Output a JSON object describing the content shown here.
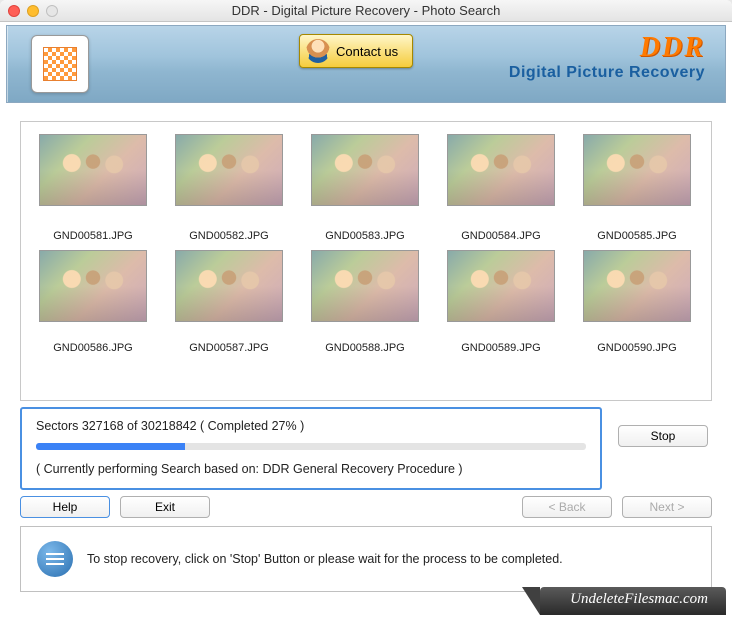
{
  "window": {
    "title": "DDR - Digital Picture Recovery - Photo Search"
  },
  "banner": {
    "contact_label": "Contact us",
    "brand_main": "DDR",
    "brand_sub": "Digital Picture Recovery"
  },
  "thumbnails": {
    "row1": [
      {
        "name": "GND00581.JPG"
      },
      {
        "name": "GND00582.JPG"
      },
      {
        "name": "GND00583.JPG"
      },
      {
        "name": "GND00584.JPG"
      },
      {
        "name": "GND00585.JPG"
      }
    ],
    "row2": [
      {
        "name": "GND00586.JPG"
      },
      {
        "name": "GND00587.JPG"
      },
      {
        "name": "GND00588.JPG"
      },
      {
        "name": "GND00589.JPG"
      },
      {
        "name": "GND00590.JPG"
      }
    ]
  },
  "progress": {
    "sectors_current": "327168",
    "sectors_total": "30218842",
    "percent": 27,
    "line1": "Sectors 327168 of 30218842   ( Completed 27% )",
    "line2": "( Currently performing Search based on: DDR General Recovery Procedure )"
  },
  "buttons": {
    "stop": "Stop",
    "help": "Help",
    "exit": "Exit",
    "back": "< Back",
    "next": "Next >"
  },
  "info": {
    "text": "To stop recovery, click on 'Stop' Button or please wait for the process to be completed."
  },
  "footer": {
    "site": "UndeleteFilesmac.com"
  }
}
